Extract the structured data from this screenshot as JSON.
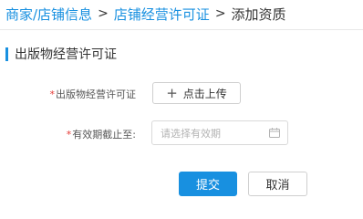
{
  "breadcrumb": {
    "items": [
      "商家/店铺信息",
      "店铺经营许可证",
      "添加资质"
    ],
    "separator": ">"
  },
  "section": {
    "title": "出版物经营许可证"
  },
  "form": {
    "license_field": {
      "required_mark": "*",
      "label": "出版物经营许可证",
      "upload_icon": "+",
      "upload_label": "点击上传"
    },
    "expiry_field": {
      "required_mark": "*",
      "label": "有效期截止至:",
      "placeholder": "请选择有效期",
      "icon": "calendar-icon"
    }
  },
  "actions": {
    "submit_label": "提交",
    "cancel_label": "取消"
  },
  "colors": {
    "accent": "#1890e0",
    "required": "#e53935"
  }
}
